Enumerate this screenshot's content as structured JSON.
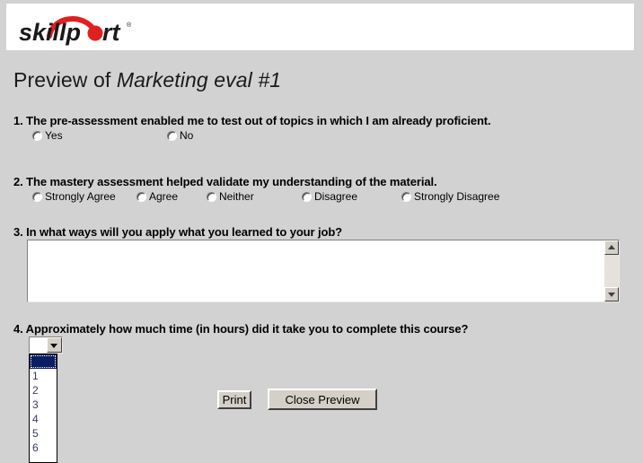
{
  "brand": {
    "logo_text_part1": "skillp",
    "logo_text_part2": "rt",
    "logo_trademark": "®",
    "logo_accent_color": "#e02020",
    "logo_text_color": "#1a1a1a"
  },
  "page": {
    "title_prefix": "Preview of ",
    "title_survey_name": "Marketing eval #1",
    "background_color": "#d2d2d2",
    "header_background_color": "#ffffff"
  },
  "questions": [
    {
      "number": "1.",
      "text": "1. The pre-assessment enabled me to test out of topics in which I am already proficient.",
      "type": "radio",
      "options": [
        {
          "label": "Yes",
          "selected": false
        },
        {
          "label": "No",
          "selected": false
        }
      ]
    },
    {
      "number": "2.",
      "text": "2. The mastery assessment helped validate my understanding of the material.",
      "type": "radio",
      "options": [
        {
          "label": "Strongly Agree",
          "selected": false
        },
        {
          "label": "Agree",
          "selected": false
        },
        {
          "label": "Neither",
          "selected": false
        },
        {
          "label": "Disagree",
          "selected": false
        },
        {
          "label": "Strongly Disagree",
          "selected": false
        }
      ]
    },
    {
      "number": "3.",
      "text": "3. In what ways will you apply what you learned to your job?",
      "type": "textarea",
      "value": "",
      "placeholder": ""
    },
    {
      "number": "4.",
      "text": "4. Approximately how much time (in hours) did it take you to complete this course?",
      "type": "select",
      "expanded": true,
      "selected_value": "",
      "options": [
        "",
        "1",
        "2",
        "3",
        "4",
        "5",
        "6"
      ]
    }
  ],
  "buttons": {
    "print_label": "Print",
    "close_preview_label": "Close Preview"
  },
  "scrollbar": {
    "up_arrow": "▲",
    "down_arrow": "▼"
  }
}
